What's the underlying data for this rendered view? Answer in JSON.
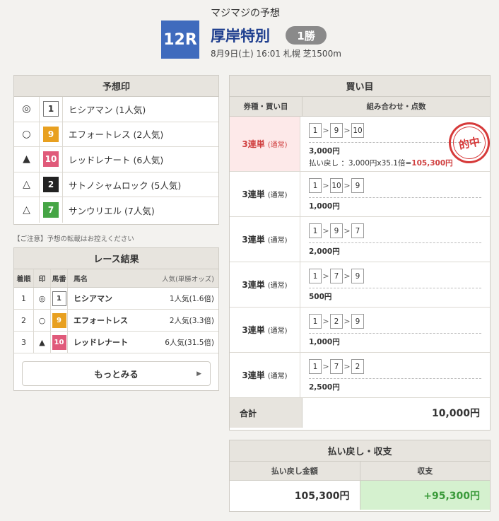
{
  "header": {
    "badge": "12R",
    "subtitle": "マジマジの予想",
    "race_name": "厚岸特別",
    "grade": "1勝",
    "meta": "8月9日(土) 16:01 札幌 芝1500m"
  },
  "prediction": {
    "title": "予想印",
    "rows": [
      {
        "mark": "◎",
        "num": "1",
        "name": "ヒシアマン",
        "pop": "(1人気)",
        "color": "c1"
      },
      {
        "mark": "○",
        "num": "9",
        "name": "エフォートレス",
        "pop": "(2人気)",
        "color": "c5"
      },
      {
        "mark": "▲",
        "num": "10",
        "name": "レッドレナート",
        "pop": "(6人気)",
        "color": "c7"
      },
      {
        "mark": "△",
        "num": "2",
        "name": "サトノシャムロック",
        "pop": "(5人気)",
        "color": "c2"
      },
      {
        "mark": "△",
        "num": "7",
        "name": "サンウリエル",
        "pop": "(7人気)",
        "color": "c6"
      }
    ]
  },
  "note": "【ご注意】予想の転載はお控えください",
  "results": {
    "title": "レース結果",
    "headers": [
      "着順",
      "印",
      "馬番",
      "馬名",
      "人気(単勝オッズ)"
    ],
    "rows": [
      {
        "pos": "1",
        "mark": "◎",
        "num": "1",
        "name": "ヒシアマン",
        "pop": "1人気(1.6倍)"
      },
      {
        "pos": "2",
        "mark": "○",
        "num": "9",
        "name": "エフォートレス",
        "pop": "2人気(3.3倍)"
      },
      {
        "pos": "3",
        "mark": "▲",
        "num": "10",
        "name": "レッドレナート",
        "pop": "6人気(31.5倍)"
      }
    ],
    "more": "もっとみる"
  },
  "buy": {
    "title": "買い目",
    "col1": "券種・買い目",
    "col2": "組み合わせ・点数",
    "type": "3連単",
    "paren": "(通常)",
    "stamp": "的中",
    "payline_prefix": "払い戻し ：3,000円x35.1倍=",
    "payline_value": "105,300円",
    "rows": [
      {
        "combo": [
          "1",
          "9",
          "10"
        ],
        "amount": "3,000円",
        "hit": true
      },
      {
        "combo": [
          "1",
          "10",
          "9"
        ],
        "amount": "1,000円",
        "hit": false
      },
      {
        "combo": [
          "1",
          "9",
          "7"
        ],
        "amount": "2,000円",
        "hit": false
      },
      {
        "combo": [
          "1",
          "7",
          "9"
        ],
        "amount": "500円",
        "hit": false
      },
      {
        "combo": [
          "1",
          "2",
          "9"
        ],
        "amount": "1,000円",
        "hit": false
      },
      {
        "combo": [
          "1",
          "7",
          "2"
        ],
        "amount": "2,500円",
        "hit": false
      }
    ],
    "total_label": "合計",
    "total_value": "10,000円"
  },
  "payout": {
    "title": "払い戻し・収支",
    "col1": "払い戻し金額",
    "col2": "収支",
    "val1": "105,300円",
    "val2": "+95,300円"
  }
}
